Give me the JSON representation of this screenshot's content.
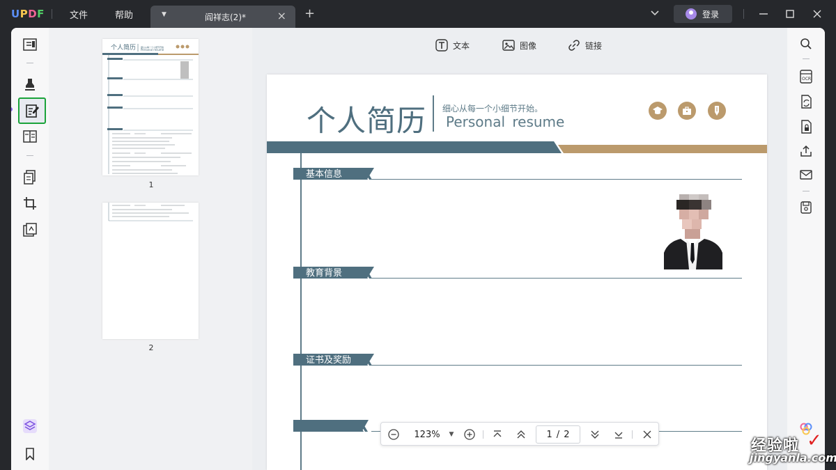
{
  "app": {
    "logo": "UPDF"
  },
  "menu": {
    "file": "文件",
    "help": "帮助"
  },
  "tab": {
    "title": "阎祥志(2)*"
  },
  "account": {
    "login_label": "登录"
  },
  "edit_toolbar": {
    "text_label": "文本",
    "image_label": "图像",
    "link_label": "链接"
  },
  "thumbnails": [
    {
      "page": "1"
    },
    {
      "page": "2"
    }
  ],
  "resume": {
    "title": "个人简历",
    "slogan": "细心从每一个小细节开始。",
    "subtitle_en": "Personal  resume",
    "sections": [
      "基本信息",
      "教育背景",
      "证书及奖励",
      ""
    ]
  },
  "zoom": {
    "value": "123%",
    "current_page": "1",
    "separator": "/",
    "total_pages": "2"
  },
  "watermark": {
    "cn": "经验啦",
    "en": "jingyanla.com",
    "check": "✓"
  },
  "colors": {
    "accent": "#1aa33a",
    "brand_teal": "#4f6f7f",
    "brand_gold": "#bb9a6c"
  }
}
